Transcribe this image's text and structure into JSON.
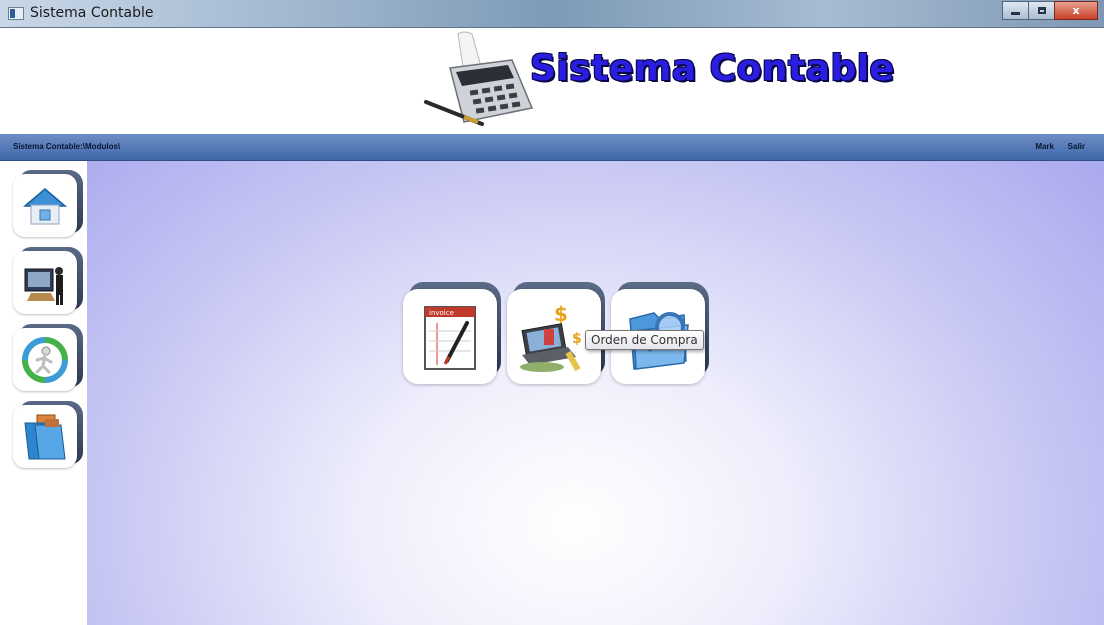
{
  "window": {
    "title": "Sistema Contable",
    "controls": {
      "minimize": "minimize-icon",
      "maximize": "maximize-icon",
      "close": "x"
    }
  },
  "header": {
    "logo_text": "Sistema Contable",
    "logo_icon": "calculator-icon"
  },
  "navbar": {
    "breadcrumb": "Sistema Contable:\\Modulos\\",
    "user": "Mark",
    "exit": "Salir"
  },
  "sidebar": {
    "items": [
      {
        "icon": "home-icon"
      },
      {
        "icon": "office-person-icon"
      },
      {
        "icon": "recycle-runner-icon"
      },
      {
        "icon": "folders-icon"
      }
    ]
  },
  "modules": [
    {
      "icon": "invoice-icon"
    },
    {
      "icon": "purchase-order-icon"
    },
    {
      "icon": "folder-search-icon"
    }
  ],
  "tooltip": {
    "text": "Orden de Compra"
  },
  "colors": {
    "navbar": "#4a71b2",
    "logo_text": "#2a1ee0",
    "main_bg_edge": "#a8a8ee",
    "tile_back": "#2d3a52"
  }
}
